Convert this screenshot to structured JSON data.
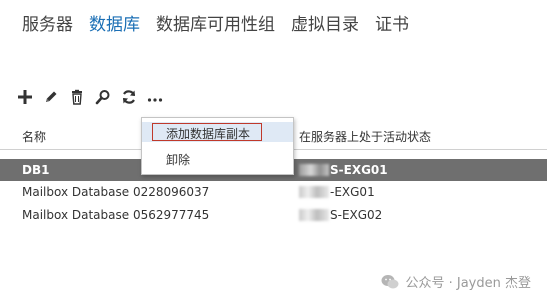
{
  "tabs": [
    {
      "label": "服务器"
    },
    {
      "label": "数据库"
    },
    {
      "label": "数据库可用性组"
    },
    {
      "label": "虚拟目录"
    },
    {
      "label": "证书"
    }
  ],
  "active_tab_color": "#1b6fb5",
  "toolbar": {
    "icons": [
      "add-icon",
      "edit-icon",
      "delete-icon",
      "search-icon",
      "refresh-icon",
      "more-icon"
    ]
  },
  "table": {
    "columns": [
      "名称",
      "在服务器上处于活动状态"
    ],
    "rows": [
      {
        "name": "DB1",
        "server": "S-EXG01",
        "selected": true
      },
      {
        "name": "Mailbox Database 0228096037",
        "server": "-EXG01",
        "selected": false
      },
      {
        "name": "Mailbox Database 0562977745",
        "server": "S-EXG02",
        "selected": false
      }
    ]
  },
  "context_menu": {
    "items": [
      {
        "label": "添加数据库副本"
      },
      {
        "label": "卸除"
      }
    ]
  },
  "watermark": {
    "text": "公众号 · Jayden 杰登"
  }
}
